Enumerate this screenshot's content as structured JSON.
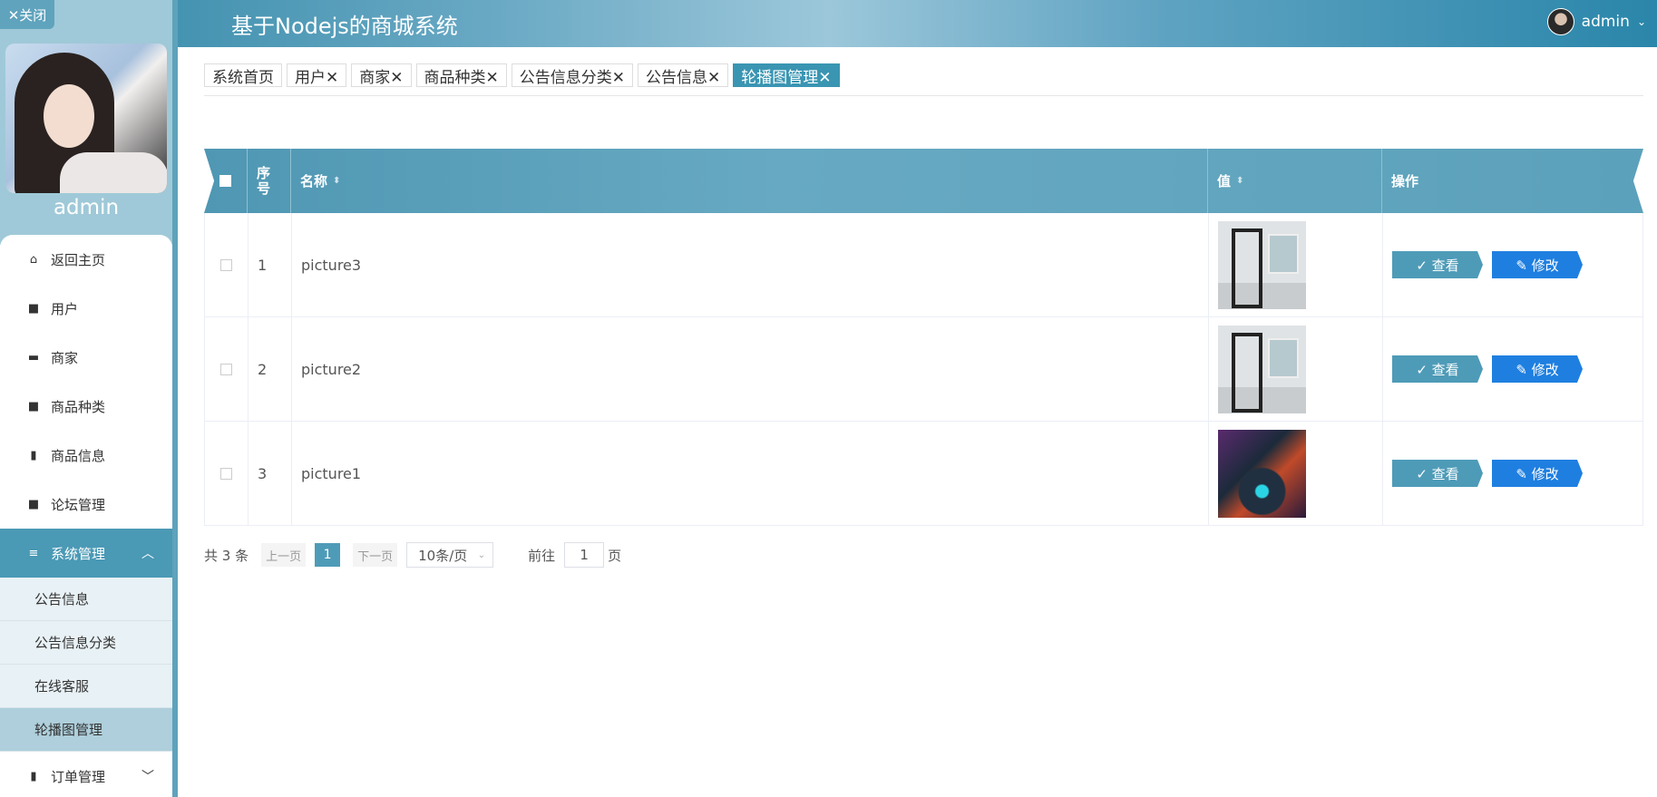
{
  "header": {
    "title": "基于Nodejs的商城系统",
    "username": "admin"
  },
  "sidebar": {
    "close_label": "✕关闭",
    "username": "admin",
    "menu": [
      {
        "icon": "home-icon",
        "glyph": "⌂",
        "label": "返回主页"
      },
      {
        "icon": "grid-icon",
        "glyph": "■",
        "label": "用户"
      },
      {
        "icon": "monitor-icon",
        "glyph": "▬",
        "label": "商家"
      },
      {
        "icon": "grid-icon",
        "glyph": "■",
        "label": "商品种类"
      },
      {
        "icon": "clipboard-icon",
        "glyph": "▮",
        "label": "商品信息"
      },
      {
        "icon": "grid-icon",
        "glyph": "■",
        "label": "论坛管理"
      }
    ],
    "system": {
      "label": "系统管理",
      "glyph": "≡"
    },
    "sub_items": [
      "公告信息",
      "公告信息分类",
      "在线客服",
      "轮播图管理"
    ],
    "orders": {
      "label": "订单管理",
      "glyph": "▮"
    }
  },
  "tabs": [
    "系统首页",
    "用户✕",
    "商家✕",
    "商品种类✕",
    "公告信息分类✕",
    "公告信息✕",
    "轮播图管理✕"
  ],
  "table": {
    "headers": {
      "index": "序\n号",
      "name": "名称",
      "value": "值",
      "ops": "操作"
    },
    "rows": [
      {
        "index": "1",
        "name": "picture3",
        "thumb": "room"
      },
      {
        "index": "2",
        "name": "picture2",
        "thumb": "room"
      },
      {
        "index": "3",
        "name": "picture1",
        "thumb": "neon"
      }
    ],
    "view_label": "✓ 查看",
    "edit_label": "✎ 修改"
  },
  "pagination": {
    "total": "共 3 条",
    "prev": "上一页",
    "current": "1",
    "next": "下一页",
    "page_size": "10条/页",
    "goto_label": "前往",
    "goto_value": "1",
    "page_suffix": "页"
  },
  "colors": {
    "accent": "#4a99b5",
    "edit": "#1f7fe0",
    "sidebar_top": "#9fc9d8"
  }
}
